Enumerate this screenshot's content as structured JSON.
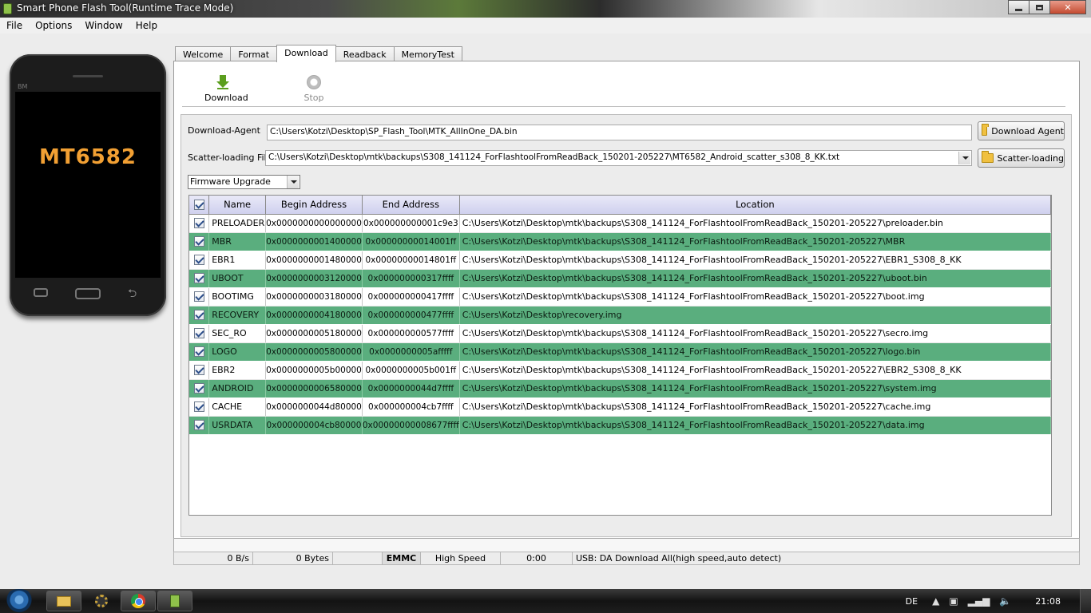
{
  "window": {
    "title": "Smart Phone Flash Tool(Runtime Trace Mode)",
    "controls": {
      "minimize": "",
      "maximize": "",
      "close": "✕"
    }
  },
  "menu": [
    "File",
    "Options",
    "Window",
    "Help"
  ],
  "phone": {
    "brand": "BM",
    "model": "MT6582"
  },
  "tabs": [
    "Welcome",
    "Format",
    "Download",
    "Readback",
    "MemoryTest"
  ],
  "active_tab": "Download",
  "toolbar": {
    "download_label": "Download",
    "stop_label": "Stop"
  },
  "download_agent": {
    "label": "Download-Agent",
    "value": "C:\\Users\\Kotzi\\Desktop\\SP_Flash_Tool\\MTK_AllInOne_DA.bin",
    "button": "Download Agent"
  },
  "scatter": {
    "label": "Scatter-loading File",
    "value": "C:\\Users\\Kotzi\\Desktop\\mtk\\backups\\S308_141124_ForFlashtoolFromReadBack_150201-205227\\MT6582_Android_scatter_s308_8_KK.txt",
    "button": "Scatter-loading"
  },
  "mode_select": "Firmware Upgrade",
  "table": {
    "columns": [
      "Name",
      "Begin Address",
      "End Address",
      "Location"
    ],
    "rows": [
      {
        "name": "PRELOADER",
        "begin": "0x0000000000000000",
        "end": "0x000000000001c9e3",
        "location": "C:\\Users\\Kotzi\\Desktop\\mtk\\backups\\S308_141124_ForFlashtoolFromReadBack_150201-205227\\preloader.bin",
        "checked": true
      },
      {
        "name": "MBR",
        "begin": "0x0000000001400000",
        "end": "0x00000000014001ff",
        "location": "C:\\Users\\Kotzi\\Desktop\\mtk\\backups\\S308_141124_ForFlashtoolFromReadBack_150201-205227\\MBR",
        "checked": true
      },
      {
        "name": "EBR1",
        "begin": "0x0000000001480000",
        "end": "0x00000000014801ff",
        "location": "C:\\Users\\Kotzi\\Desktop\\mtk\\backups\\S308_141124_ForFlashtoolFromReadBack_150201-205227\\EBR1_S308_8_KK",
        "checked": true
      },
      {
        "name": "UBOOT",
        "begin": "0x0000000003120000",
        "end": "0x000000000317ffff",
        "location": "C:\\Users\\Kotzi\\Desktop\\mtk\\backups\\S308_141124_ForFlashtoolFromReadBack_150201-205227\\uboot.bin",
        "checked": true
      },
      {
        "name": "BOOTIMG",
        "begin": "0x0000000003180000",
        "end": "0x000000000417ffff",
        "location": "C:\\Users\\Kotzi\\Desktop\\mtk\\backups\\S308_141124_ForFlashtoolFromReadBack_150201-205227\\boot.img",
        "checked": true
      },
      {
        "name": "RECOVERY",
        "begin": "0x0000000004180000",
        "end": "0x000000000477ffff",
        "location": "C:\\Users\\Kotzi\\Desktop\\recovery.img",
        "checked": true
      },
      {
        "name": "SEC_RO",
        "begin": "0x0000000005180000",
        "end": "0x000000000577ffff",
        "location": "C:\\Users\\Kotzi\\Desktop\\mtk\\backups\\S308_141124_ForFlashtoolFromReadBack_150201-205227\\secro.img",
        "checked": true
      },
      {
        "name": "LOGO",
        "begin": "0x0000000005800000",
        "end": "0x0000000005afffff",
        "location": "C:\\Users\\Kotzi\\Desktop\\mtk\\backups\\S308_141124_ForFlashtoolFromReadBack_150201-205227\\logo.bin",
        "checked": true
      },
      {
        "name": "EBR2",
        "begin": "0x0000000005b00000",
        "end": "0x0000000005b001ff",
        "location": "C:\\Users\\Kotzi\\Desktop\\mtk\\backups\\S308_141124_ForFlashtoolFromReadBack_150201-205227\\EBR2_S308_8_KK",
        "checked": true
      },
      {
        "name": "ANDROID",
        "begin": "0x0000000006580000",
        "end": "0x0000000044d7ffff",
        "location": "C:\\Users\\Kotzi\\Desktop\\mtk\\backups\\S308_141124_ForFlashtoolFromReadBack_150201-205227\\system.img",
        "checked": true
      },
      {
        "name": "CACHE",
        "begin": "0x0000000044d80000",
        "end": "0x000000004cb7ffff",
        "location": "C:\\Users\\Kotzi\\Desktop\\mtk\\backups\\S308_141124_ForFlashtoolFromReadBack_150201-205227\\cache.img",
        "checked": true
      },
      {
        "name": "USRDATA",
        "begin": "0x000000004cb80000",
        "end": "0x00000000008677ffff",
        "location": "C:\\Users\\Kotzi\\Desktop\\mtk\\backups\\S308_141124_ForFlashtoolFromReadBack_150201-205227\\data.img",
        "checked": true
      }
    ]
  },
  "status": {
    "speed": "0 B/s",
    "bytes": "0 Bytes",
    "storage": "EMMC",
    "mode": "High Speed",
    "time": "0:00",
    "usb": "USB: DA Download All(high speed,auto detect)"
  },
  "taskbar": {
    "lang": "DE",
    "clock": "21:08"
  },
  "colors": {
    "highlight_row": "#5aae7e",
    "header": "#cfd0ee"
  }
}
